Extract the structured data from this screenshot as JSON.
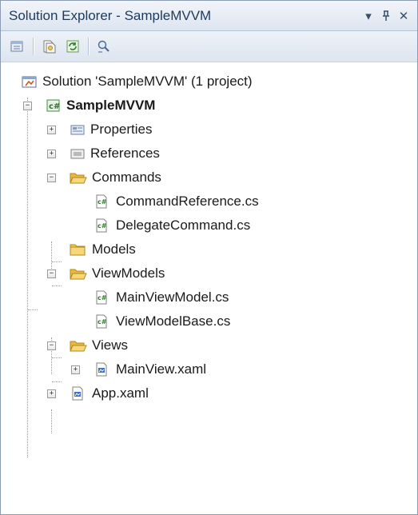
{
  "window": {
    "title": "Solution Explorer - SampleMVVM",
    "dropdown_glyph": "▾",
    "pin_glyph": "ᵻ",
    "close_glyph": "✕"
  },
  "toolbar": {
    "buttons": [
      "properties-icon",
      "show-all-files-icon",
      "refresh-icon",
      "class-diagram-icon"
    ]
  },
  "tree": {
    "solution": "Solution 'SampleMVVM' (1 project)",
    "project": "SampleMVVM",
    "properties": "Properties",
    "references": "References",
    "commands": "Commands",
    "command_reference": "CommandReference.cs",
    "delegate_command": "DelegateCommand.cs",
    "models": "Models",
    "viewmodels": "ViewModels",
    "main_view_model": "MainViewModel.cs",
    "view_model_base": "ViewModelBase.cs",
    "views": "Views",
    "main_view": "MainView.xaml",
    "app": "App.xaml"
  },
  "colors": {
    "title_text": "#1e395b",
    "folder": "#f2c94c",
    "csharp_icon": "#3f8f3f",
    "xaml_icon": "#3c6fc7"
  }
}
